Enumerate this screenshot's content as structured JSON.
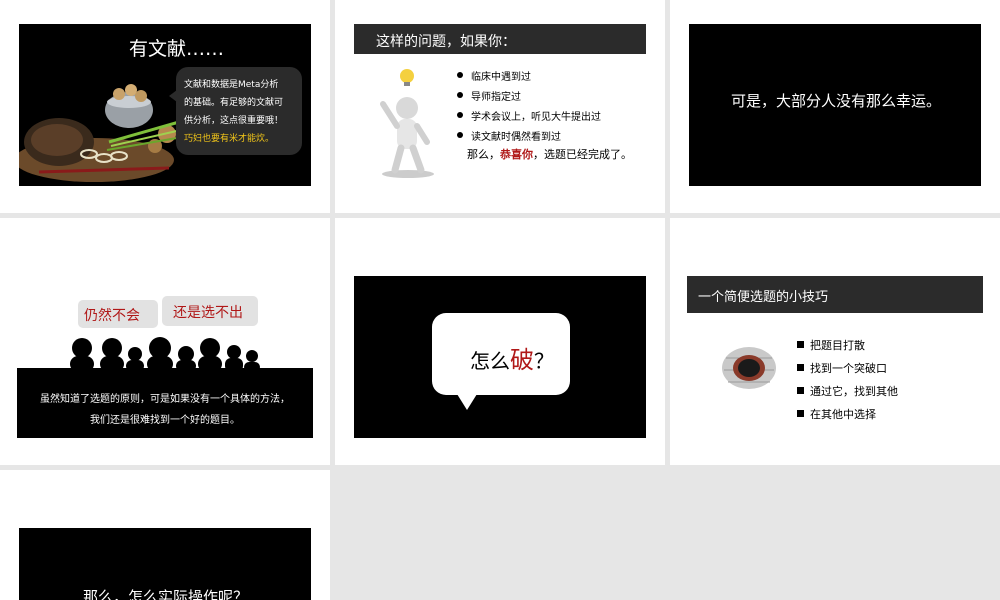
{
  "slide1": {
    "title": "有文献……",
    "bubble_line1": "文献和数据是Meta分析",
    "bubble_line2": "的基础。有足够的文献可",
    "bubble_line3": "供分析，这点很重要哦！",
    "bubble_line4": "巧妇也要有米才能炊。"
  },
  "slide2": {
    "header": "这样的问题，如果你：",
    "bullets": [
      "临床中遇到过",
      "导师指定过",
      "学术会议上，听见大牛提出过",
      "读文献时偶然看到过"
    ],
    "closing_pre": "那么，",
    "closing_em": "恭喜你",
    "closing_post": "，选题已经完成了。"
  },
  "slide3": {
    "text": "可是，大部分人没有那么幸运。"
  },
  "slide4": {
    "bubble_a": "仍然不会",
    "bubble_b": "还是选不出",
    "line1": "虽然知道了选题的原则，可是如果没有一个具体的方法，",
    "line2": "我们还是很难找到一个好的题目。"
  },
  "slide5": {
    "pre": "怎么",
    "em": "破",
    "post": "？"
  },
  "slide6": {
    "header": "一个简便选题的小技巧",
    "bullets": [
      "把题目打散",
      "找到一个突破口",
      "通过它，找到其他",
      "在其他中选择"
    ]
  },
  "slide7": {
    "text": "那么，怎么实际操作呢？"
  },
  "colors": {
    "background": "#e6e6e6",
    "accent_red": "#b01818",
    "gold": "#f0c419",
    "dark_header": "#2b2b2b"
  }
}
